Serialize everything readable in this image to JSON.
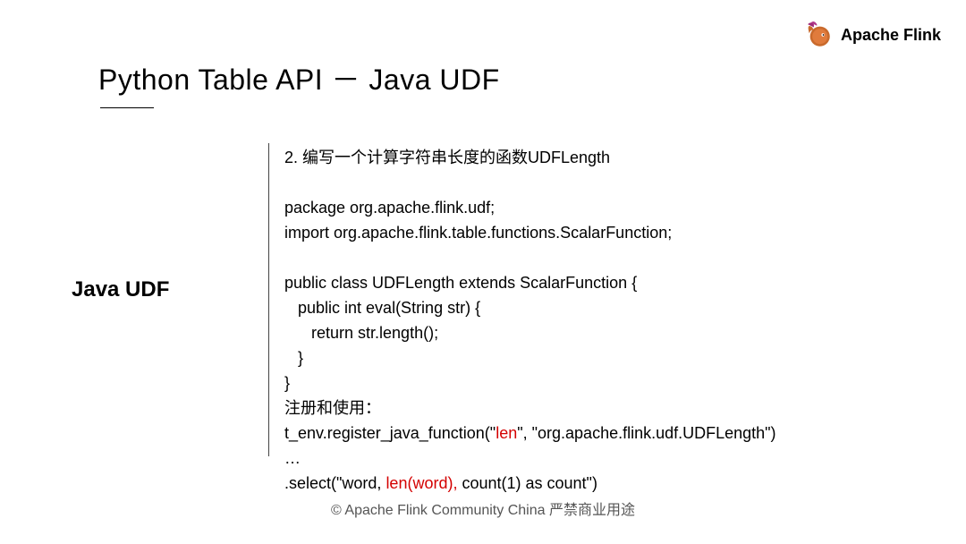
{
  "logo": {
    "text": "Apache Flink"
  },
  "title": "Python Table API － Java UDF",
  "sectionLabel": "Java UDF",
  "content": {
    "heading": "2. 编写一个计算字符串长度的函数UDFLength",
    "code1_l1": "package org.apache.flink.udf;",
    "code1_l2": "import org.apache.flink.table.functions.ScalarFunction;",
    "code2_l1": "public class UDFLength extends ScalarFunction {",
    "code2_l2": "   public int eval(String str) {",
    "code2_l3": "      return str.length();",
    "code2_l4": "   }",
    "code2_l5": "}",
    "registerLabel": "注册和使用：",
    "reg_l1_a": "t_env.register_java_function(\"",
    "reg_l1_b": "len",
    "reg_l1_c": "\", \"org.apache.flink.udf.UDFLength\")",
    "reg_l2": "…",
    "reg_l3_a": ".select(\"word, ",
    "reg_l3_b": "len(word),",
    "reg_l3_c": " count(1) as count\")"
  },
  "footer": "© Apache Flink Community China  严禁商业用途"
}
